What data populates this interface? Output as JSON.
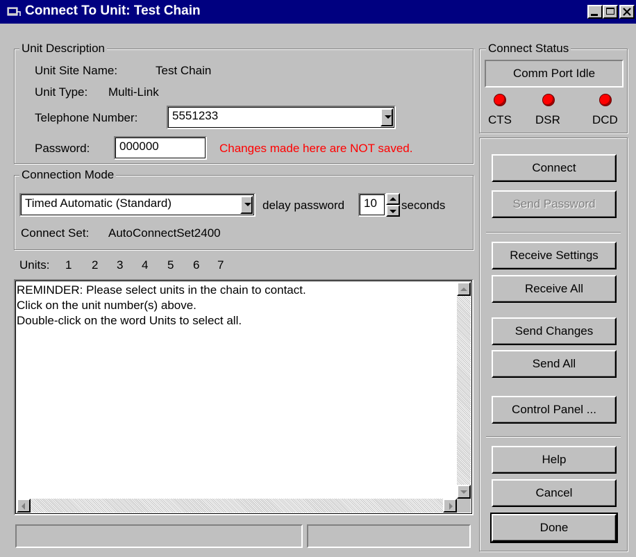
{
  "window": {
    "title": "Connect To Unit: Test Chain"
  },
  "unit_description": {
    "group_label": "Unit Description",
    "site_name_label": "Unit Site Name:",
    "site_name_value": "Test Chain",
    "unit_type_label": "Unit Type:",
    "unit_type_value": "Multi-Link",
    "telephone_label": "Telephone Number:",
    "telephone_value": "5551233",
    "password_label": "Password:",
    "password_value": "000000",
    "warning": "Changes made here are NOT saved.",
    "warning_color": "#ff0000"
  },
  "connection_mode": {
    "group_label": "Connection Mode",
    "mode_selected": "Timed Automatic (Standard)",
    "delay_label": "delay password",
    "delay_value": "10",
    "seconds_label": "seconds",
    "connect_set_label": "Connect Set:",
    "connect_set_value": "AutoConnectSet2400"
  },
  "units": {
    "label": "Units:",
    "numbers": [
      "1",
      "2",
      "3",
      "4",
      "5",
      "6",
      "7"
    ]
  },
  "memo": {
    "lines": [
      "REMINDER:  Please select units in the chain to contact.",
      "Click on the unit number(s) above.",
      "Double-click on the word Units to select all."
    ]
  },
  "status": {
    "group_label": "Connect Status",
    "port_status": "Comm Port Idle",
    "leds": [
      {
        "label": "CTS",
        "color": "#ff0000"
      },
      {
        "label": "DSR",
        "color": "#ff0000"
      },
      {
        "label": "DCD",
        "color": "#ff0000"
      }
    ]
  },
  "buttons": {
    "connect": "Connect",
    "send_password": "Send Password",
    "receive_settings": "Receive Settings",
    "receive_all": "Receive All",
    "send_changes": "Send Changes",
    "send_all": "Send All",
    "control_panel": "Control Panel ...",
    "help": "Help",
    "cancel": "Cancel",
    "done": "Done"
  },
  "theme": {
    "titlebar_color": "#000080",
    "face_color": "#c0c0c0"
  }
}
